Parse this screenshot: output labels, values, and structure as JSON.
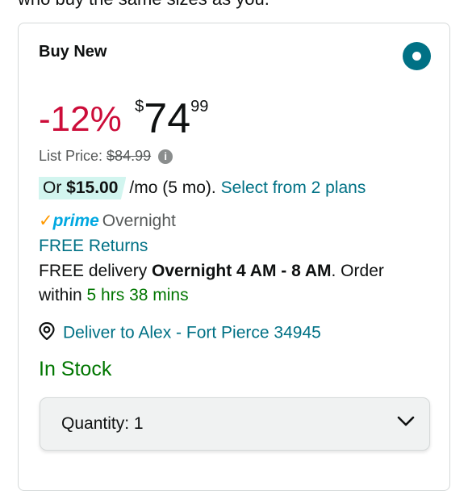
{
  "top_text": "who buy the same sizes as you.",
  "offer": {
    "title": "Buy New",
    "discount": "-12%",
    "price": {
      "symbol": "$",
      "whole": "74",
      "fraction": "99"
    },
    "list_price_label": "List Price:",
    "list_price_value": "$84.99",
    "plan": {
      "or_label": "Or",
      "monthly": "$15.00",
      "term": "/mo (5 mo).",
      "select_link": "Select from 2 plans"
    },
    "prime": {
      "check": "✓",
      "word": "prime",
      "service": "Overnight"
    },
    "free_returns": "FREE Returns",
    "delivery": {
      "prefix": "FREE delivery",
      "window": "Overnight 4 AM - 8 AM",
      "mid": ". Order within",
      "countdown": "5 hrs 38 mins"
    },
    "deliver_to": "Deliver to Alex - Fort Pierce 34945",
    "stock_status": "In Stock",
    "quantity": {
      "label": "Quantity:",
      "value": "1"
    }
  },
  "icons": {
    "info": "info-icon",
    "location": "location-pin-icon",
    "chevron": "chevron-down-icon"
  },
  "colors": {
    "accent_teal": "#007185",
    "discount_red": "#cc0c39",
    "stock_green": "#007600",
    "prime_blue": "#00a8e1",
    "prime_orange": "#ff9900"
  }
}
